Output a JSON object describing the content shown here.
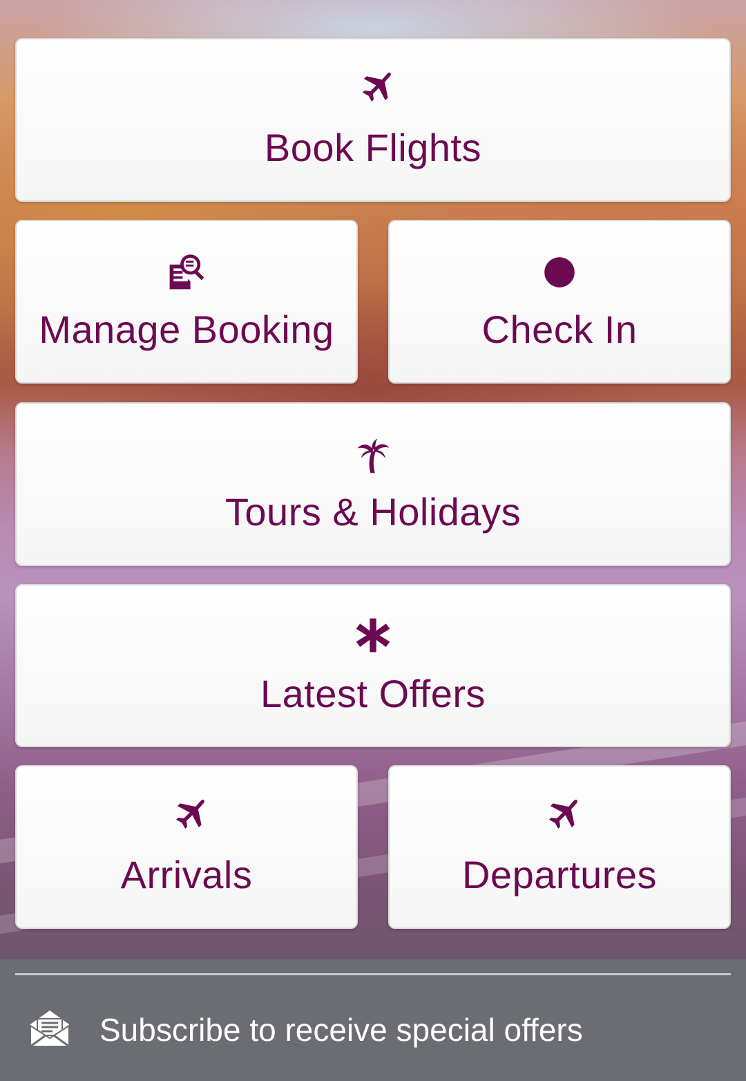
{
  "colors": {
    "accent": "#6b0a52",
    "tile_background": "#f7f7f7",
    "footer_background": "#6c6d72"
  },
  "tiles": {
    "book_flights": {
      "label": "Book Flights",
      "icon": "airplane-icon"
    },
    "manage_booking": {
      "label": "Manage Booking",
      "icon": "document-search-icon"
    },
    "check_in": {
      "label": "Check In",
      "icon": "globe-icon"
    },
    "tours_holidays": {
      "label": "Tours & Holidays",
      "icon": "palm-tree-icon"
    },
    "latest_offers": {
      "label": "Latest Offers",
      "icon": "asterisk-icon"
    },
    "arrivals": {
      "label": "Arrivals",
      "icon": "airplane-icon"
    },
    "departures": {
      "label": "Departures",
      "icon": "airplane-icon"
    }
  },
  "footer": {
    "subscribe_label": "Subscribe to receive special offers",
    "icon": "mail-open-icon"
  }
}
